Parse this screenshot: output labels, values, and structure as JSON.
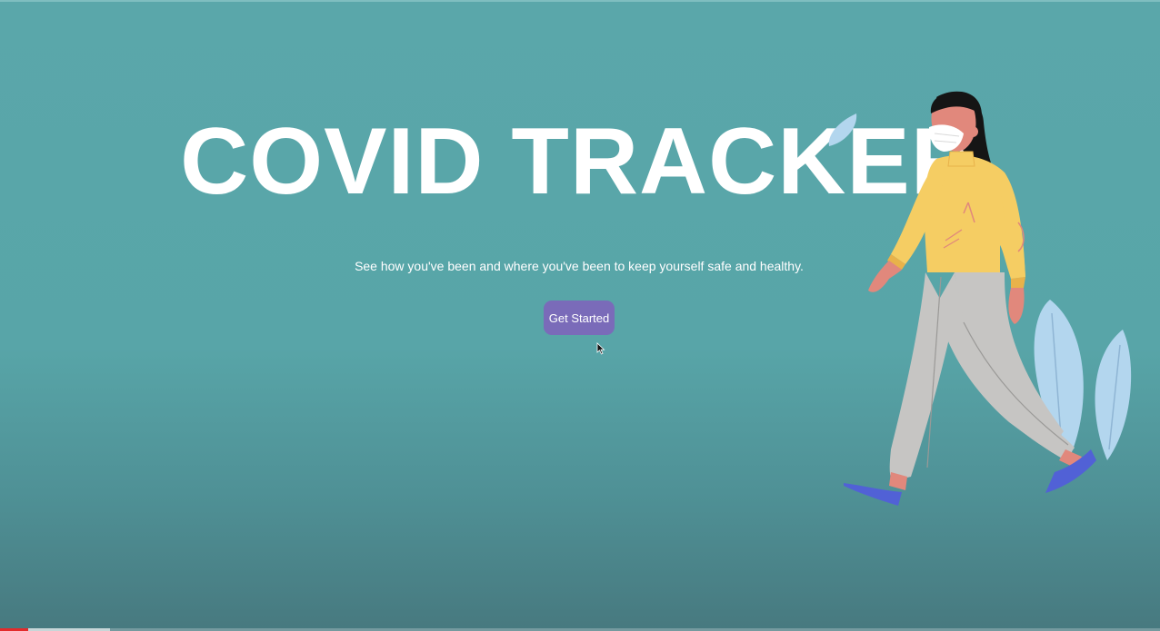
{
  "hero": {
    "title": "COVID TRACKER",
    "subtitle": "See how you've been and where you've been to keep yourself safe and healthy.",
    "cta_label": "Get Started"
  },
  "colors": {
    "background": "#5aa7aa",
    "title": "#ffffff",
    "cta_background": "#7a6bb9",
    "cta_text": "#ffffff"
  },
  "illustration": {
    "description_icon": "walking-woman-with-mask-illustration"
  },
  "video_progress": {
    "played_fraction": 0.024,
    "buffered_fraction": 0.095
  }
}
